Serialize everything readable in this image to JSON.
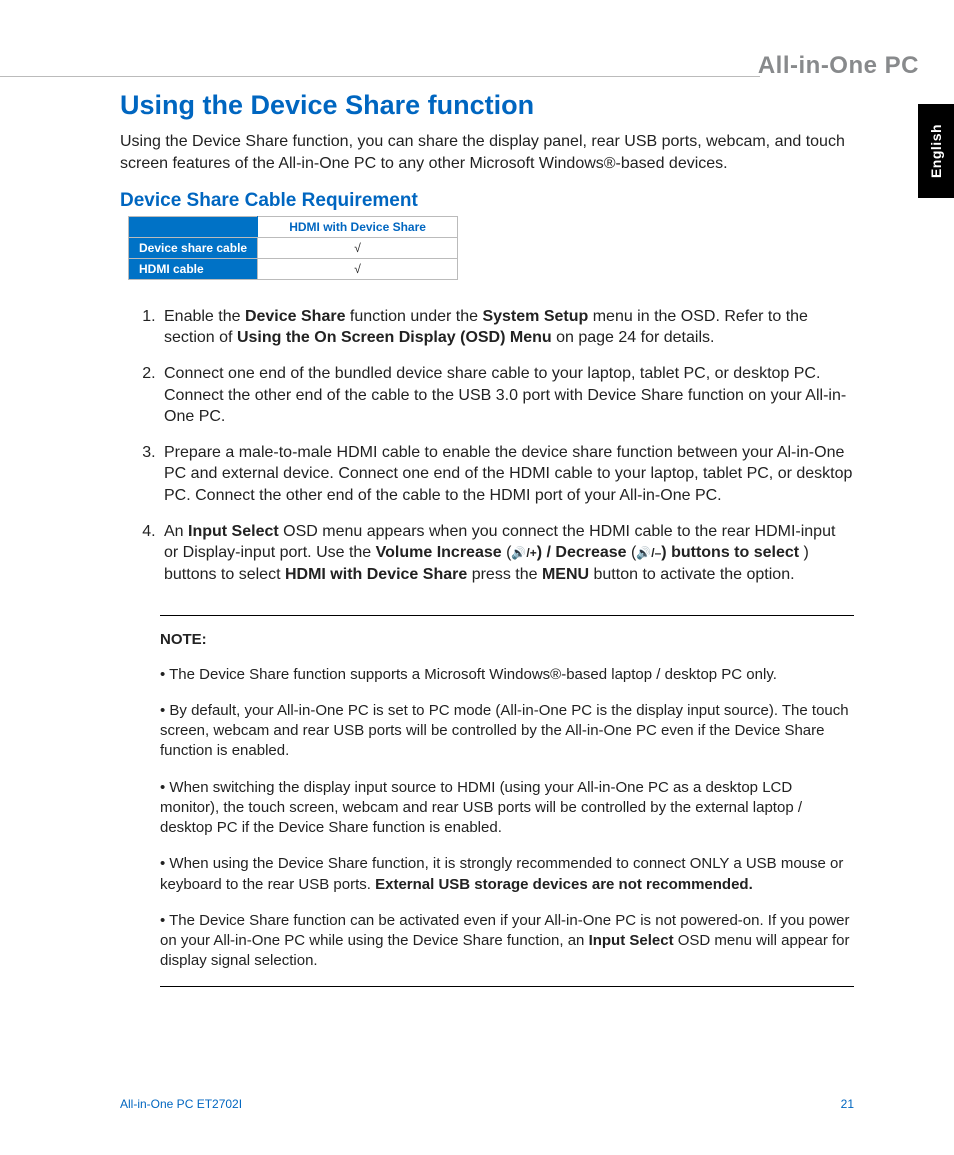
{
  "brand": "All-in-One PC",
  "language_tab": "English",
  "heading": "Using the Device Share function",
  "intro": "Using the Device Share function, you can share the display panel, rear USB ports, webcam, and touch screen features of the All-in-One PC to any other Microsoft Windows®-based devices.",
  "subheading": "Device Share Cable Requirement",
  "table": {
    "col_header": "HDMI with Device Share",
    "rows": [
      {
        "label": "Device share cable",
        "value": "√"
      },
      {
        "label": "HDMI cable",
        "value": "√"
      }
    ]
  },
  "steps": {
    "s1_a": "Enable the ",
    "s1_b1": "Device Share",
    "s1_c": " function under the ",
    "s1_b2": "System Setup",
    "s1_d": " menu in the OSD. Refer to the section of ",
    "s1_b3": "Using the On Screen Display (OSD) Menu",
    "s1_e": " on page 24 for details.",
    "s2": "Connect one end of the bundled device share cable to your laptop, tablet PC, or desktop PC. Connect the other end of the cable to the USB 3.0 port with Device Share function on your All-in-One PC.",
    "s3": "Prepare a male-to-male HDMI cable to enable the device share function between your Al-in-One PC and external device. Connect one end of the HDMI cable to your laptop, tablet PC, or desktop PC. Connect the other end of the cable to the HDMI port of your All-in-One PC.",
    "s4_a": "An ",
    "s4_b1": "Input Select",
    "s4_c": " OSD menu appears when you connect the HDMI cable to the rear HDMI-input or Display-input port. Use the ",
    "s4_b2": "Volume Increase",
    "s4_d": " (",
    "s4_icon1": "🔊/+",
    "s4_e": ") / ",
    "s4_b3": "Decrease",
    "s4_f": " (",
    "s4_icon2": "🔊/–",
    "s4_g": ") buttons to select ",
    "s4_b4": "HDMI with Device Share",
    "s4_h": " press the ",
    "s4_b5": "MENU",
    "s4_i": " button to activate the option."
  },
  "note": {
    "label": "NOTE:",
    "n1": "• The Device Share function supports a Microsoft Windows®-based laptop / desktop PC only.",
    "n2": "• By default, your All-in-One PC is set to PC mode (All-in-One PC is the display input source). The touch screen, webcam and rear USB ports will be controlled by the All-in-One PC even if the Device Share function is enabled.",
    "n3": "• When switching the display input source to HDMI (using your All-in-One PC as a desktop LCD monitor), the touch screen, webcam and rear USB ports will be controlled by the external laptop / desktop PC if the Device Share function is enabled.",
    "n4_a": "• When using the Device Share function, it is strongly recommended to connect ONLY a USB mouse or keyboard to the rear USB ports. ",
    "n4_b": "External USB storage devices are not recommended.",
    "n5_a": "• The Device Share function can be activated even if your All-in-One PC is not powered-on. If you power on your All-in-One PC while using the Device Share function, an ",
    "n5_b": "Input Select",
    "n5_c": " OSD menu will appear for display signal selection."
  },
  "footer": {
    "model": "All-in-One PC ET2702I",
    "page": "21"
  }
}
